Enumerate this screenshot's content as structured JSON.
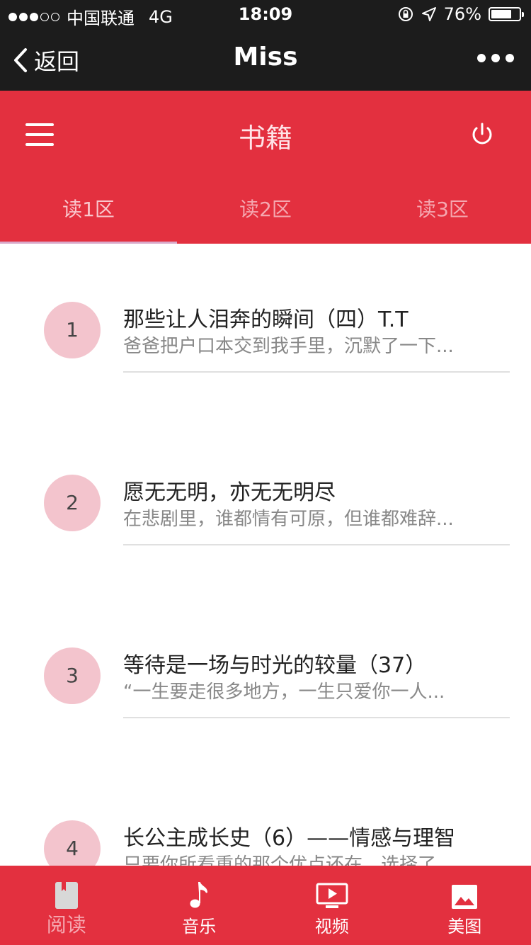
{
  "status_bar": {
    "carrier": "中国联通",
    "network": "4G",
    "time": "18:09",
    "battery": "76%",
    "battery_level": 0.76
  },
  "nav": {
    "back_label": "返回",
    "title": "Miss"
  },
  "header": {
    "title": "书籍",
    "tabs": [
      {
        "label": "读1区"
      },
      {
        "label": "读2区"
      },
      {
        "label": "读3区"
      }
    ]
  },
  "list": {
    "items": [
      {
        "num": "1",
        "title": "那些让人泪奔的瞬间（四）T.T",
        "subtitle": "爸爸把户口本交到我手里，沉默了一下..."
      },
      {
        "num": "2",
        "title": "愿无无明，亦无无明尽",
        "subtitle": "在悲剧里，谁都情有可原，但谁都难辞..."
      },
      {
        "num": "3",
        "title": "等待是一场与时光的较量（37）",
        "subtitle": "“一生要走很多地方，一生只爱你一人..."
      },
      {
        "num": "4",
        "title": "长公主成长史（6）——情感与理智",
        "subtitle": "只要你所看重的那个优点还在，选择了"
      }
    ]
  },
  "bottom_nav": {
    "items": [
      {
        "label": "阅读",
        "icon": "book-icon"
      },
      {
        "label": "音乐",
        "icon": "music-note-icon"
      },
      {
        "label": "视频",
        "icon": "video-play-icon"
      },
      {
        "label": "美图",
        "icon": "image-icon"
      }
    ]
  },
  "colors": {
    "accent": "#e3303f",
    "nav_background": "#1c1c1c",
    "badge": "#f3c4cd"
  }
}
